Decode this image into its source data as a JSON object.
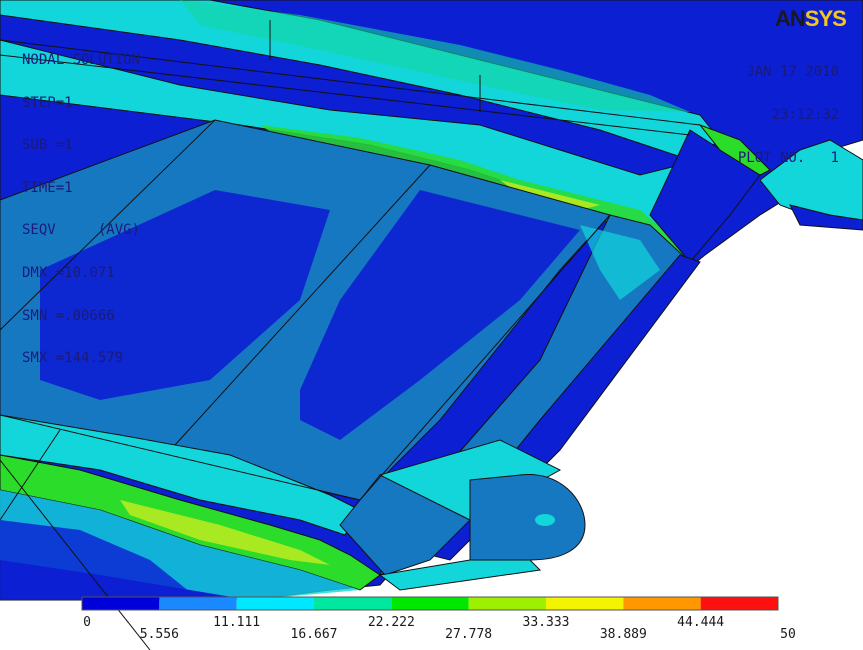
{
  "logo": {
    "part1": "AN",
    "part2": "SYS"
  },
  "info": {
    "lines": [
      "NODAL SOLUTION",
      "STEP=1",
      "SUB =1",
      "TIME=1",
      "SEQV     (AVG)",
      "DMX =10.071",
      "SMN =.00666",
      "SMX =144.579"
    ]
  },
  "date": {
    "lines": [
      "JAN 17 2010",
      "23:12:32",
      "PLOT NO.   1"
    ]
  },
  "legend": {
    "colors": [
      "#0000d8",
      "#1a88ff",
      "#00e8ff",
      "#00e8a0",
      "#00e800",
      "#9cf000",
      "#f4f400",
      "#ff9800",
      "#ff1010"
    ],
    "ticks": [
      "0",
      "5.556",
      "11.111",
      "16.667",
      "22.222",
      "27.778",
      "33.333",
      "38.889",
      "44.444",
      "50"
    ]
  },
  "colors": {
    "dark_blue": "#0d1fd3",
    "mid_blue": "#1778c2",
    "cyan": "#13d6da",
    "teal": "#12d6a0",
    "green": "#2bdc2b",
    "yellowgreen": "#b7ea20",
    "yellow": "#e8e838",
    "edge": "#111111"
  }
}
